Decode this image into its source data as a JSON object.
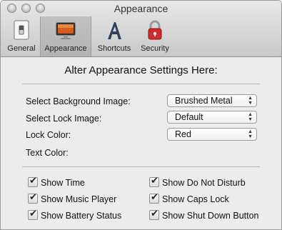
{
  "window": {
    "title": "Appearance"
  },
  "toolbar": {
    "items": [
      {
        "label": "General",
        "icon": "switch-icon"
      },
      {
        "label": "Appearance",
        "icon": "display-icon",
        "selected": true
      },
      {
        "label": "Shortcuts",
        "icon": "letter-a-icon"
      },
      {
        "label": "Security",
        "icon": "padlock-icon"
      }
    ]
  },
  "main": {
    "heading": "Alter Appearance Settings Here:",
    "background_label": "Select Background Image:",
    "background_value": "Brushed Metal",
    "lock_image_label": "Select Lock Image:",
    "lock_image_value": "Default",
    "lock_color_label": "Lock Color:",
    "lock_color_value": "Red",
    "text_color_label": "Text Color:"
  },
  "options": {
    "show_time": "Show Time",
    "show_music_player": "Show Music Player",
    "show_battery_status": "Show Battery Status",
    "show_do_not_disturb": "Show Do Not Disturb",
    "show_caps_lock": "Show Caps Lock",
    "show_shut_down_button": "Show Shut Down Button"
  }
}
